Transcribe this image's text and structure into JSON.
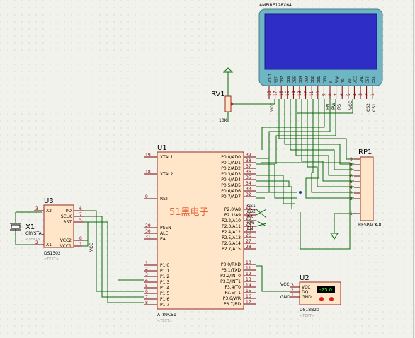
{
  "lcd": {
    "title": "AMPIRE128X64",
    "pins": [
      "VOUT",
      "RST",
      "DB7",
      "DB6",
      "DB5",
      "DB4",
      "DB3",
      "DB2",
      "DB1",
      "DB0",
      "E",
      "R/W",
      "RS",
      "V0",
      "VCC",
      "GND",
      "CS2",
      "CS1"
    ],
    "nums": [
      "18",
      "17",
      "16",
      "15",
      "14",
      "13",
      "12",
      "11",
      "10",
      "9",
      "8",
      "7",
      "6",
      "5",
      "4",
      "3",
      "2",
      "1"
    ],
    "vcc": "VCC",
    "en": "EN",
    "rw": "RW",
    "rs": "RS",
    "cs1": "CS1",
    "cs2": "CS2"
  },
  "rv1": {
    "ref": "RV1",
    "value": "10K"
  },
  "u1": {
    "ref": "U1",
    "part": "AT89C51",
    "text": "<TEXT>",
    "left_pins": [
      {
        "n": "19",
        "name": "XTAL1"
      },
      {
        "n": "18",
        "name": "XTAL2"
      },
      {
        "n": "9",
        "name": "RST"
      },
      {
        "n": "29",
        "name": "PSEN"
      },
      {
        "n": "30",
        "name": "ALE"
      },
      {
        "n": "31",
        "name": "EA"
      },
      {
        "n": "1",
        "name": "P1.0"
      },
      {
        "n": "2",
        "name": "P1.1"
      },
      {
        "n": "3",
        "name": "P1.2"
      },
      {
        "n": "4",
        "name": "P1.3"
      },
      {
        "n": "5",
        "name": "P1.4"
      },
      {
        "n": "6",
        "name": "P1.5"
      },
      {
        "n": "7",
        "name": "P1.6"
      },
      {
        "n": "8",
        "name": "P1.7"
      }
    ],
    "right_pins": [
      {
        "n": "39",
        "name": "P0.0/AD0"
      },
      {
        "n": "38",
        "name": "P0.1/AD1"
      },
      {
        "n": "37",
        "name": "P0.2/AD2"
      },
      {
        "n": "36",
        "name": "P0.3/AD3"
      },
      {
        "n": "35",
        "name": "P0.4/AD4"
      },
      {
        "n": "34",
        "name": "P0.5/AD5"
      },
      {
        "n": "33",
        "name": "P0.6/AD6"
      },
      {
        "n": "32",
        "name": "P0.7/AD7"
      },
      {
        "n": "21",
        "name": "P2.0/A8"
      },
      {
        "n": "22",
        "name": "P2.1/A9"
      },
      {
        "n": "23",
        "name": "P2.2/A10"
      },
      {
        "n": "24",
        "name": "P2.3/A11"
      },
      {
        "n": "25",
        "name": "P2.4/A12"
      },
      {
        "n": "26",
        "name": "P2.5/A13"
      },
      {
        "n": "27",
        "name": "P2.6/A14"
      },
      {
        "n": "28",
        "name": "P2.7/A15"
      },
      {
        "n": "10",
        "name": "P3.0/RXD"
      },
      {
        "n": "11",
        "name": "P3.1/TXD"
      },
      {
        "n": "12",
        "name": "P3.2/INT0"
      },
      {
        "n": "13",
        "name": "P3.3/INT1"
      },
      {
        "n": "14",
        "name": "P3.4/T0"
      },
      {
        "n": "15",
        "name": "P3.5/T1"
      },
      {
        "n": "16",
        "name": "P3.6/WR"
      },
      {
        "n": "17",
        "name": "P3.7/RD"
      }
    ],
    "net_labels": [
      "CS1",
      "CS2",
      "RS",
      "RW",
      "EN"
    ]
  },
  "watermark": "51黑电子",
  "rp1": {
    "ref": "RP1",
    "part": "RESPACK-8",
    "pins": [
      "9",
      "8",
      "7",
      "6",
      "5",
      "4",
      "3",
      "2",
      "1"
    ]
  },
  "u3": {
    "ref": "U3",
    "part": "DS1302",
    "text": "<TEXT>",
    "pins_left": [
      {
        "n": "3",
        "name": "X2"
      },
      {
        "n": "2",
        "name": "X1"
      }
    ],
    "pins_right": [
      {
        "n": "6",
        "name": "I/O"
      },
      {
        "n": "7",
        "name": "SCLK"
      },
      {
        "n": "5",
        "name": "RST"
      },
      {
        "n": "8",
        "name": "VCC2"
      },
      {
        "n": "1",
        "name": "VCC1"
      }
    ],
    "vcc": "VCC"
  },
  "x1": {
    "ref": "X1",
    "part": "CRYSTAL",
    "text": "<TEXT>"
  },
  "u2": {
    "ref": "U2",
    "part": "DS18B20",
    "text": "<TEXT>",
    "pins": [
      {
        "n": "3",
        "name": "VCC"
      },
      {
        "n": "2",
        "name": "DQ"
      },
      {
        "n": "1",
        "name": "GND"
      }
    ],
    "vcc": "VCC",
    "gnd": "GND",
    "reading": "-25.0"
  }
}
